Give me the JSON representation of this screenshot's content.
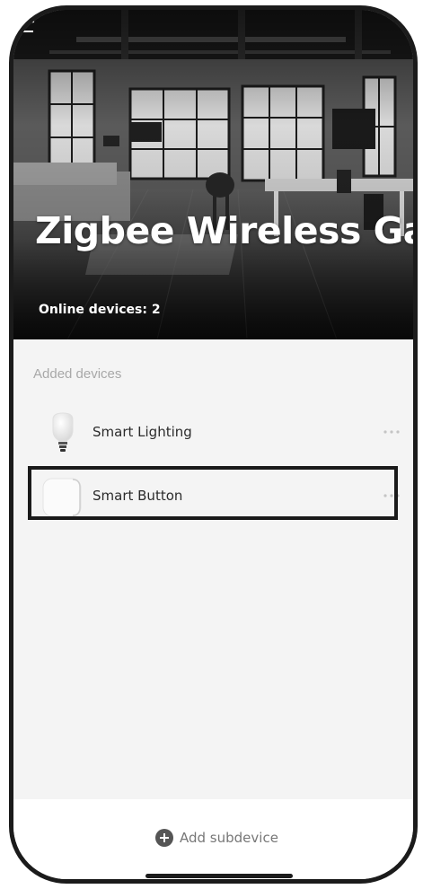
{
  "header": {
    "title": "Zigbee Wireless Gat...",
    "online_devices": "Online devices: 2"
  },
  "devices_section": {
    "label": "Added devices",
    "items": [
      {
        "name": "Smart Lighting",
        "icon": "light-bulb-icon",
        "more_icon": "more-options-icon"
      },
      {
        "name": "Smart Button",
        "icon": "button-icon",
        "more_icon": "more-options-icon"
      }
    ]
  },
  "footer": {
    "add_label": "Add subdevice",
    "add_icon": "plus-circle-icon"
  },
  "colors": {
    "text": "#2b2b2b",
    "muted": "#a8a8a8",
    "background": "#f4f4f4",
    "footer_bg": "#ffffff",
    "highlight": "#1a1a1a"
  }
}
